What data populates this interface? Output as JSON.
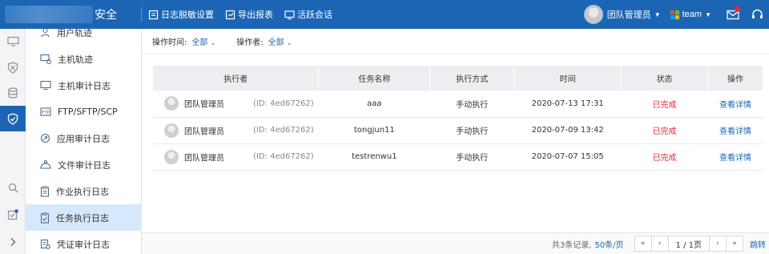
{
  "header": {
    "brand_suffix": "安全",
    "actions": [
      {
        "label": "日志脱敏设置",
        "icon": "log-settings-icon"
      },
      {
        "label": "导出报表",
        "icon": "export-report-icon"
      },
      {
        "label": "活跃会话",
        "icon": "active-session-icon"
      }
    ],
    "user_name": "团队管理员",
    "team_name": "team",
    "brand_color": "#1c65b5"
  },
  "rail": {
    "items": [
      "monitor-icon",
      "shield-x-icon",
      "database-icon",
      "shield-active-icon"
    ],
    "bottom": [
      "search-icon",
      "task-check-icon",
      "chevron-right-icon"
    ]
  },
  "submenu": {
    "items": [
      {
        "label": "用户轨迹",
        "icon": "user-track-icon"
      },
      {
        "label": "主机轨迹",
        "icon": "host-track-icon"
      },
      {
        "label": "主机审计日志",
        "icon": "host-audit-icon"
      },
      {
        "label": "FTP/SFTP/SCP",
        "icon": "ftp-icon"
      },
      {
        "label": "应用审计日志",
        "icon": "app-audit-icon"
      },
      {
        "label": "文件审计日志",
        "icon": "file-audit-icon"
      },
      {
        "label": "作业执行日志",
        "icon": "job-log-icon"
      },
      {
        "label": "任务执行日志",
        "icon": "task-log-icon",
        "active": true
      },
      {
        "label": "凭证审计日志",
        "icon": "credential-audit-icon"
      }
    ]
  },
  "filters": {
    "op_time_label": "操作时间:",
    "op_time_value": "全部",
    "operator_label": "操作者:",
    "operator_value": "全部"
  },
  "table": {
    "columns": [
      "执行者",
      "任务名称",
      "执行方式",
      "时间",
      "状态",
      "操作"
    ],
    "rows": [
      {
        "executor": "团队管理员",
        "id": "(ID:  4ed67262)",
        "task": "aaa",
        "mode": "手动执行",
        "time": "2020-07-13 17:31",
        "status": "已完成",
        "action": "查看详情"
      },
      {
        "executor": "团队管理员",
        "id": "(ID:  4ed67262)",
        "task": "tongjun11",
        "mode": "手动执行",
        "time": "2020-07-09 13:42",
        "status": "已完成",
        "action": "查看详情"
      },
      {
        "executor": "团队管理员",
        "id": "(ID:  4ed67262)",
        "task": "testrenwu1",
        "mode": "手动执行",
        "time": "2020-07-07 15:05",
        "status": "已完成",
        "action": "查看详情"
      }
    ]
  },
  "pagination": {
    "total": "共3条记录,",
    "page_size": "50条/页",
    "page": "1 / 1页",
    "jump": "跳转"
  }
}
